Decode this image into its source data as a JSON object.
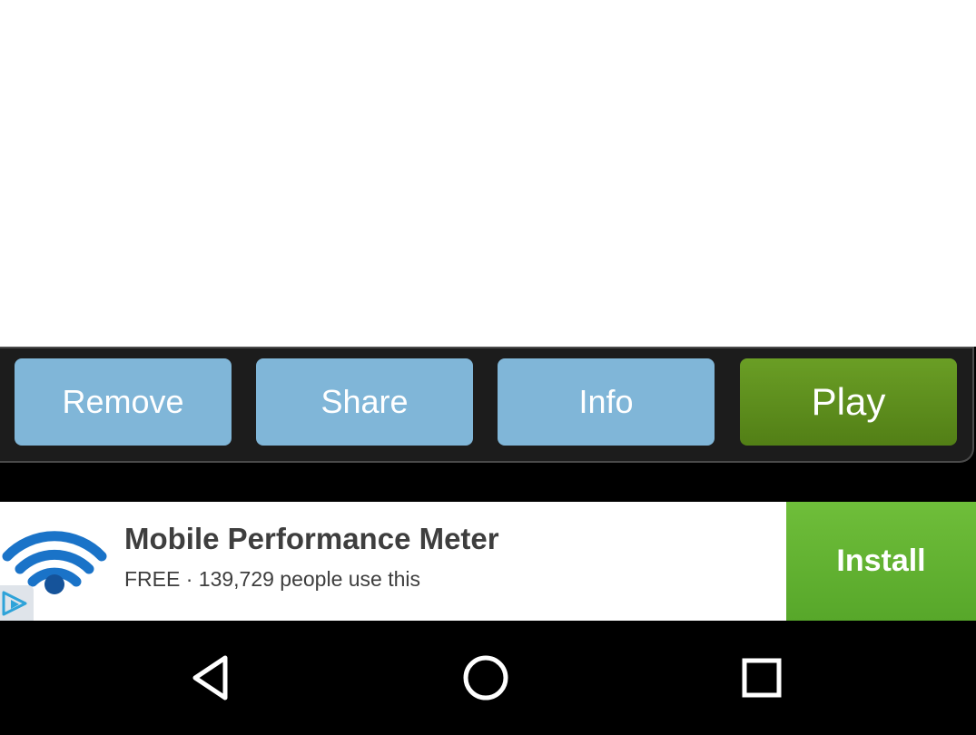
{
  "actions": {
    "remove_label": "Remove",
    "share_label": "Share",
    "info_label": "Info",
    "play_label": "Play"
  },
  "ad": {
    "title": "Mobile Performance Meter",
    "subtitle": "FREE · 139,729 people use this",
    "install_label": "Install",
    "app_icon": "wifi-icon",
    "badge_icon": "ad-choices-icon"
  },
  "nav": {
    "back_icon": "back-triangle-icon",
    "home_icon": "home-circle-icon",
    "recents_icon": "recents-square-icon"
  },
  "colors": {
    "secondary_button": "#80b6d8",
    "play_button": "#5f8f1e",
    "install_button": "#62b332",
    "ad_text": "#3e3e3e"
  }
}
